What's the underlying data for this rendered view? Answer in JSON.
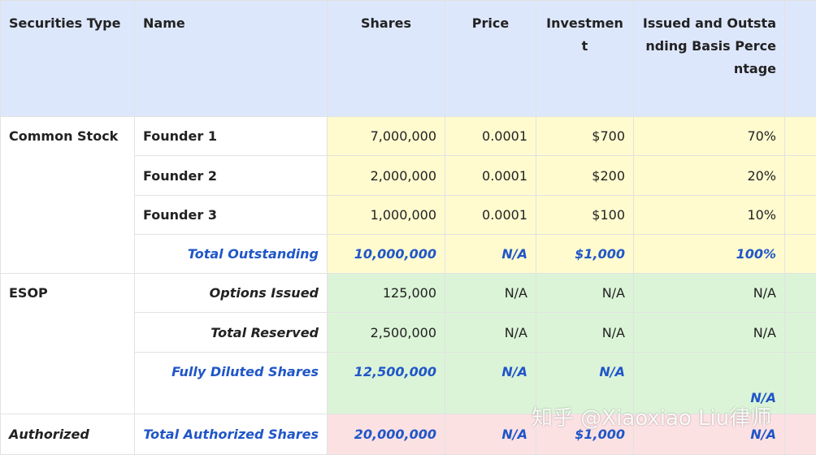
{
  "headers": {
    "type": "Securities Type",
    "name": "Name",
    "shares": "Shares",
    "price": "Price",
    "investment": "Investment",
    "percentage": "Issued and Outstanding Basis Percentage"
  },
  "common_stock": {
    "type": "Common Stock",
    "rows": [
      {
        "name": "Founder 1",
        "shares": "7,000,000",
        "price": "0.0001",
        "investment": "$700",
        "percentage": "70%"
      },
      {
        "name": "Founder 2",
        "shares": "2,000,000",
        "price": "0.0001",
        "investment": "$200",
        "percentage": "20%"
      },
      {
        "name": "Founder 3",
        "shares": "1,000,000",
        "price": "0.0001",
        "investment": "$100",
        "percentage": "10%"
      }
    ],
    "total": {
      "name": "Total Outstanding",
      "shares": "10,000,000",
      "price": "N/A",
      "investment": "$1,000",
      "percentage": "100%"
    }
  },
  "esop": {
    "type": "ESOP",
    "rows": [
      {
        "name": "Options Issued",
        "shares": "125,000",
        "price": "N/A",
        "investment": "N/A",
        "percentage": "N/A"
      },
      {
        "name": "Total Reserved",
        "shares": "2,500,000",
        "price": "N/A",
        "investment": "N/A",
        "percentage": "N/A"
      }
    ],
    "total": {
      "name": "Fully Diluted Shares",
      "shares": "12,500,000",
      "price": "N/A",
      "investment": "N/A",
      "percentage": "N/A"
    }
  },
  "authorized": {
    "type": "Authorized",
    "total": {
      "name": "Total Authorized Shares",
      "shares": "20,000,000",
      "price": "N/A",
      "investment": "$1,000",
      "percentage": "N/A"
    }
  },
  "watermark": "知乎 @Xiaoxiao Liu律师"
}
